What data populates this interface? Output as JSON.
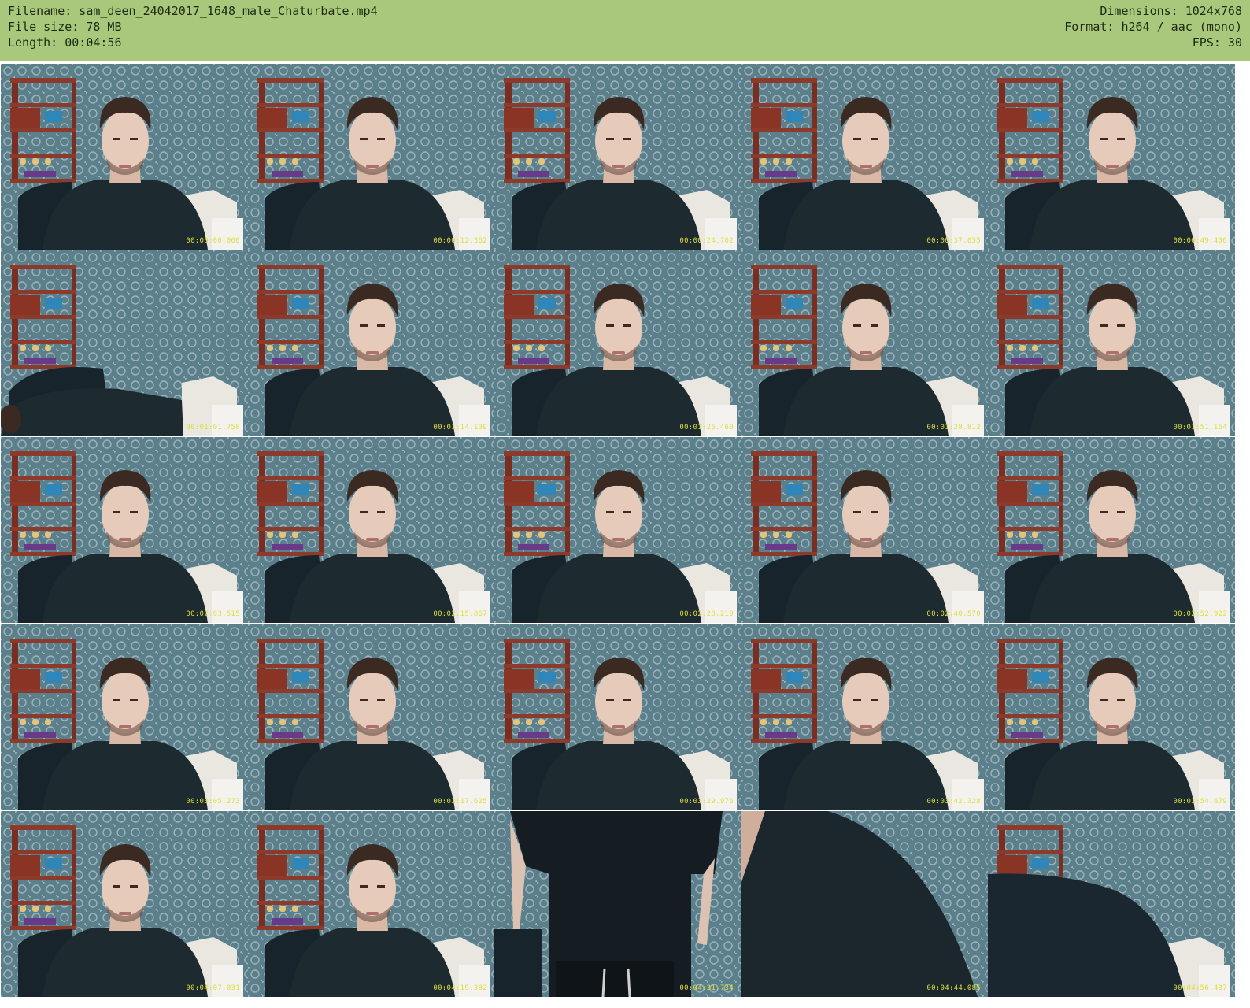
{
  "info": {
    "filename_label": "Filename: sam_deen_24042017_1648_male_Chaturbate.mp4",
    "filesize_label": "File size: 78 MB",
    "length_label": "Length: 00:04:56",
    "dimensions_label": "Dimensions: 1024x768",
    "format_label": "Format: h264 / aac (mono)",
    "fps_label": "FPS: 30"
  },
  "colors": {
    "header_bg": "#a9c87c",
    "timestamp": "#dede3c",
    "wallpaper": "#5c7f8c",
    "shelf": "#7a2e22",
    "sweater": "#1d2a2f"
  },
  "thumbnails": [
    {
      "timestamp": "00:00:00.000",
      "pose": "center"
    },
    {
      "timestamp": "00:00:12.362",
      "pose": "center"
    },
    {
      "timestamp": "00:00:24.702",
      "pose": "center"
    },
    {
      "timestamp": "00:00:37.055",
      "pose": "center"
    },
    {
      "timestamp": "00:00:49.406",
      "pose": "center"
    },
    {
      "timestamp": "00:01:01.758",
      "pose": "leaning"
    },
    {
      "timestamp": "00:01:14.109",
      "pose": "center"
    },
    {
      "timestamp": "00:01:26.460",
      "pose": "center"
    },
    {
      "timestamp": "00:01:38.812",
      "pose": "center"
    },
    {
      "timestamp": "00:01:51.164",
      "pose": "center"
    },
    {
      "timestamp": "00:02:03.515",
      "pose": "center"
    },
    {
      "timestamp": "00:02:15.867",
      "pose": "center"
    },
    {
      "timestamp": "00:02:28.219",
      "pose": "center"
    },
    {
      "timestamp": "00:02:40.570",
      "pose": "center"
    },
    {
      "timestamp": "00:02:52.922",
      "pose": "center"
    },
    {
      "timestamp": "00:03:05.273",
      "pose": "center"
    },
    {
      "timestamp": "00:03:17.625",
      "pose": "center"
    },
    {
      "timestamp": "00:03:29.976",
      "pose": "center"
    },
    {
      "timestamp": "00:03:42.328",
      "pose": "center"
    },
    {
      "timestamp": "00:03:54.679",
      "pose": "center"
    },
    {
      "timestamp": "00:04:07.031",
      "pose": "center"
    },
    {
      "timestamp": "00:04:19.382",
      "pose": "center"
    },
    {
      "timestamp": "00:04:31.734",
      "pose": "standing"
    },
    {
      "timestamp": "00:04:44.085",
      "pose": "closeup"
    },
    {
      "timestamp": "00:04:56.437",
      "pose": "blocked"
    }
  ]
}
